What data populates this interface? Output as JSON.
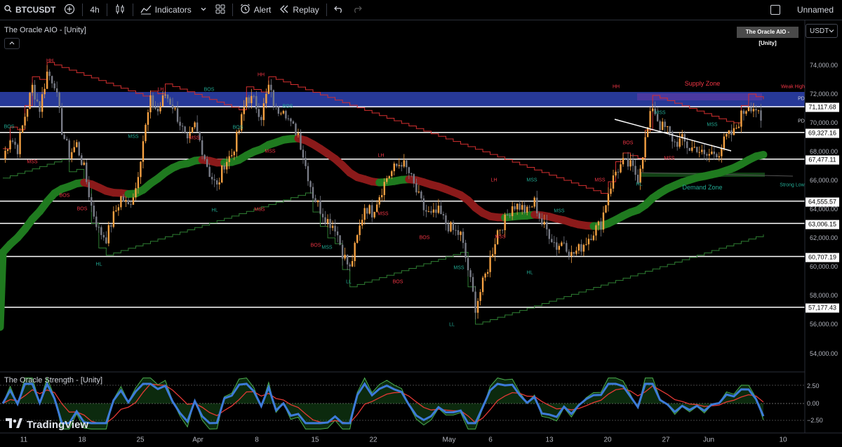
{
  "toolbar": {
    "symbol": "BTCUSDT",
    "interval": "4h",
    "indicators_label": "Indicators",
    "alert_label": "Alert",
    "replay_label": "Replay",
    "layout_name": "Unnamed"
  },
  "main_pane": {
    "title": "The Oracle AIO - [Unity]",
    "badge": "The Oracle AIO - [Unity]",
    "currency": "USDT"
  },
  "osc_pane": {
    "title": "The Oracle Strength - [Unity]"
  },
  "brand": "TradingView",
  "price_axis": [
    "74,000.00",
    "72,000.00",
    "70,000.00",
    "68,000.00",
    "66,000.00",
    "64,000.00",
    "62,000.00",
    "60,000.00",
    "58,000.00",
    "56,000.00",
    "54,000.00"
  ],
  "price_tags": [
    "71,117.68",
    "69,327.16",
    "67,477.11",
    "64,555.57",
    "63,006.15",
    "60,707.19",
    "57,177.43"
  ],
  "osc_axis": [
    "2.50",
    "0.00",
    "−2.50"
  ],
  "time_axis": [
    "11",
    "18",
    "25",
    "Apr",
    "8",
    "15",
    "22",
    "May",
    "6",
    "13",
    "20",
    "27",
    "Jun",
    "10"
  ],
  "labels": {
    "hh": "HH",
    "lh": "LH",
    "hl": "HL",
    "ll": "LL",
    "bos": "BOS",
    "mss": "MSS",
    "supply_zone": "Supply Zone",
    "demand_zone": "Demand Zone",
    "weak_high": "Weak High",
    "strong_low": "Strong Low",
    "pd": "PD"
  },
  "colors": {
    "bull": "#f5a142",
    "bear": "#787b86",
    "up_ema": "#1f7a1f",
    "down_ema": "#8b1a1a",
    "supply": "#2b3fa8"
  },
  "chart_data": {
    "type": "candlestick",
    "ylim": [
      53000,
      75500
    ],
    "levels": [
      71117.68,
      69327.16,
      67477.11,
      64555.57,
      63006.15,
      60707.19,
      57177.43
    ],
    "close": [
      67500,
      69000,
      68200,
      70500,
      72500,
      71000,
      73500,
      72800,
      69500,
      67800,
      68500,
      66800,
      64200,
      62500,
      62000,
      63500,
      64800,
      64200,
      65500,
      68800,
      71500,
      70800,
      72000,
      71200,
      70000,
      68500,
      69800,
      68200,
      66500,
      65500,
      67200,
      67800,
      69500,
      71800,
      71500,
      70500,
      72500,
      70800,
      71200,
      69800,
      69300,
      67000,
      65000,
      64000,
      63200,
      62800,
      61000,
      59800,
      62000,
      64200,
      63800,
      65000,
      66200,
      66800,
      67300,
      66500,
      65200,
      64000,
      63500,
      63800,
      63000,
      62500,
      62200,
      59800,
      57200,
      58800,
      60500,
      62500,
      63200,
      64300,
      64200,
      63800,
      64500,
      63000,
      62300,
      61400,
      61800,
      60800,
      61200,
      61800,
      62500,
      63000,
      65200,
      66600,
      67200,
      67000,
      66200,
      68800,
      71200,
      69800,
      69500,
      68600,
      68800,
      68200,
      68300,
      67600,
      67900,
      68000,
      69000,
      69300,
      70500,
      71300,
      71000,
      69300
    ]
  }
}
